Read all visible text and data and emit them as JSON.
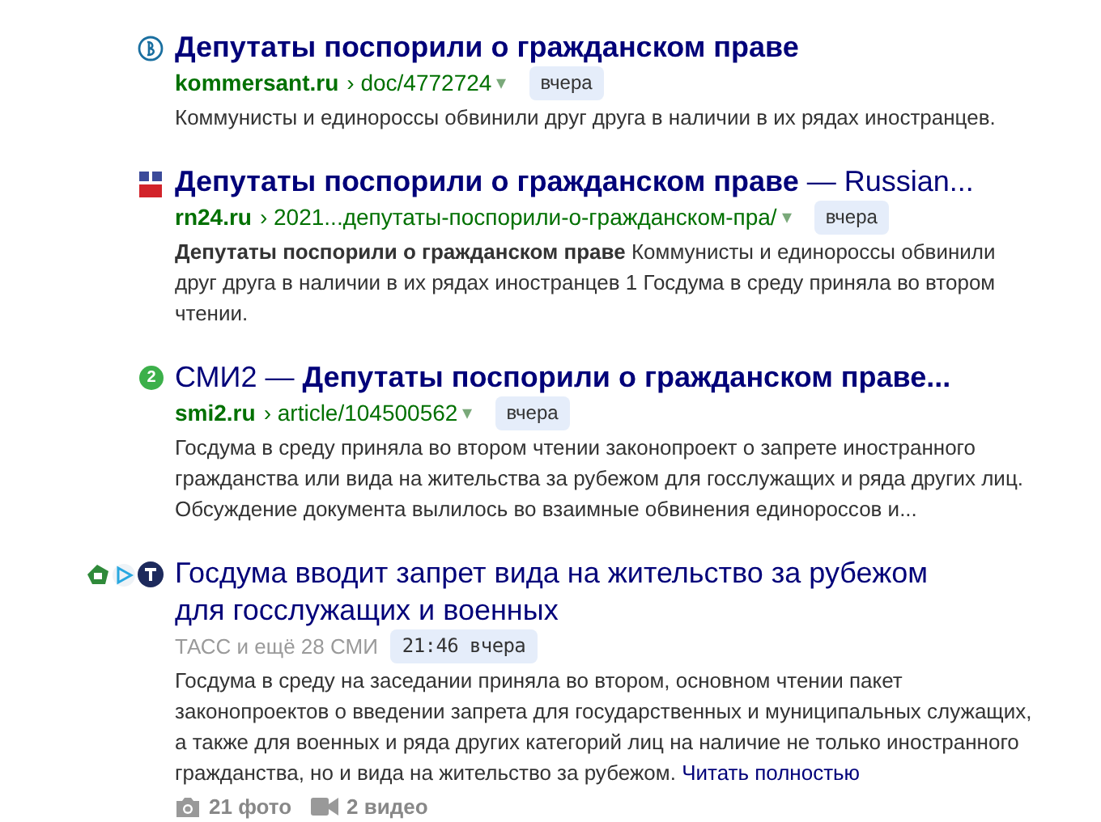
{
  "results": [
    {
      "kind": "site",
      "title": "Депутаты поспорили о гражданском праве",
      "title_bold": true,
      "domain": "kommersant.ru",
      "path": "› doc/4772724",
      "menu": "▾",
      "date": "вчера",
      "snippet": "Коммунисты и единороссы обвинили друг друга в наличии в их рядах иностранцев."
    },
    {
      "kind": "site",
      "title": "**Депутаты поспорили о гражданском праве** — Russian...",
      "title_bold": false,
      "domain": "rn24.ru",
      "path": "› 2021...депутаты-поспорили-о-гражданском-пра/",
      "menu": "▾",
      "date": "вчера",
      "snippet": "**Депутаты поспорили о гражданском праве** Коммунисты и единороссы обвинили друг друга в наличии в их рядах иностранцев 1 Госдума в среду приняла во втором чтении."
    },
    {
      "kind": "site",
      "badge": "2",
      "title": "СМИ2 — **Депутаты поспорили о гражданском праве...**",
      "title_bold": false,
      "domain": "smi2.ru",
      "path": "› article/104500562",
      "menu": "▾",
      "date": "вчера",
      "snippet": "Госдума в среду приняла во втором чтении законопроект о запрете иностранного гражданства или вида на жительства за рубежом для госслужащих и ряда других лиц. Обсуждение документа вылилось во взаимные обвинения единороссов и..."
    },
    {
      "kind": "story",
      "title": "Госдума вводит запрет вида на жительство за рубежом для госслужащих и военных",
      "title_bold": false,
      "sources": "ТАСС и ещё 28 СМИ",
      "date": "21:46 вчера",
      "snippet": "Госдума в среду на заседании приняла во втором, основном чтении пакет законопроектов о введении запрета для государственных и муниципальных служащих, а также для военных и ряда других категорий лиц на наличие не только иностранного гражданства, но и вида на жительство за рубежом.",
      "read_more": "Читать полностью",
      "photos": "21 фото",
      "videos": "2 видео"
    }
  ]
}
